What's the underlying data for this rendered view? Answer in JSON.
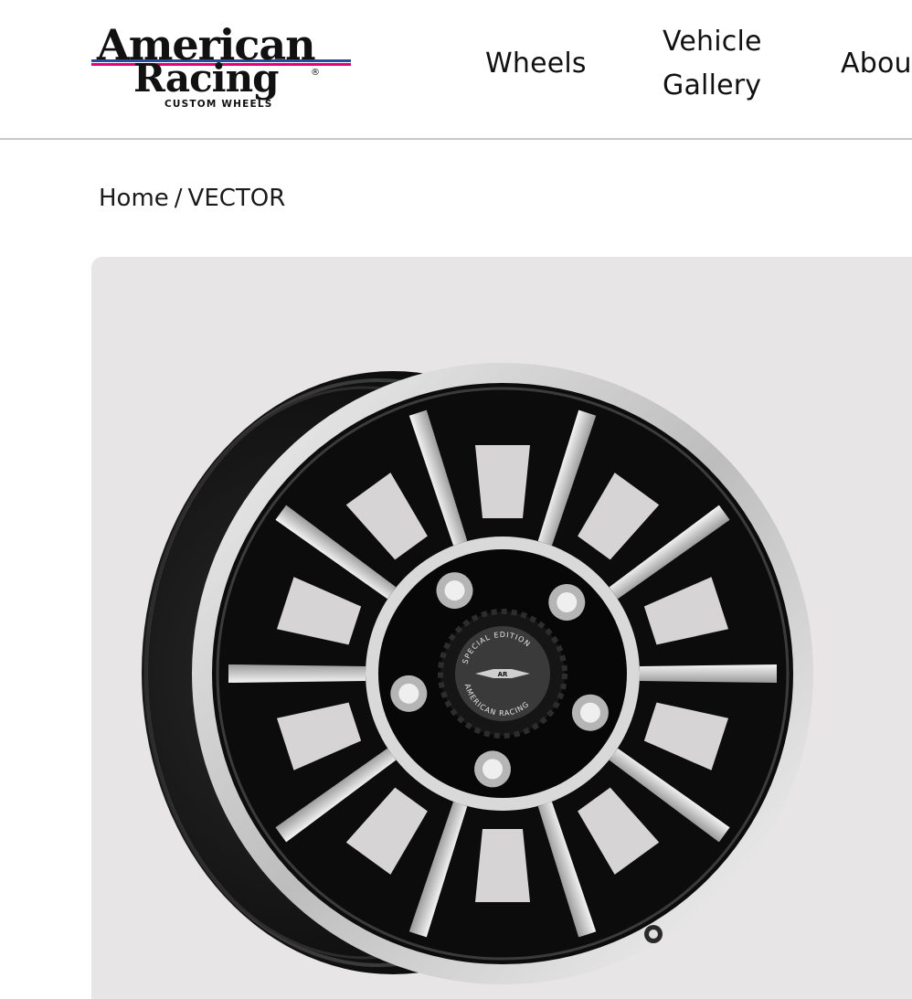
{
  "header": {
    "logo": {
      "line1": "American",
      "line2": "Racing",
      "tagline": "CUSTOM WHEELS",
      "registered": "®"
    },
    "nav": [
      {
        "label": "Wheels"
      },
      {
        "label_line1": "Vehicle",
        "label_line2": "Gallery"
      },
      {
        "label": "About"
      }
    ]
  },
  "breadcrumb": {
    "home": "Home",
    "separator": "/",
    "current": "VECTOR"
  },
  "product": {
    "image_icon": "wheel-image",
    "center_cap": {
      "top_text": "SPECIAL EDITION",
      "bottom_text": "AMERICAN RACING",
      "badge": "AR"
    }
  },
  "colors": {
    "panel_bg": "#e7e5e6",
    "logo_pink": "#e4007c",
    "logo_blue": "#2a4a9c",
    "wheel_black": "#111111",
    "wheel_machined": "#d9d9d9"
  }
}
